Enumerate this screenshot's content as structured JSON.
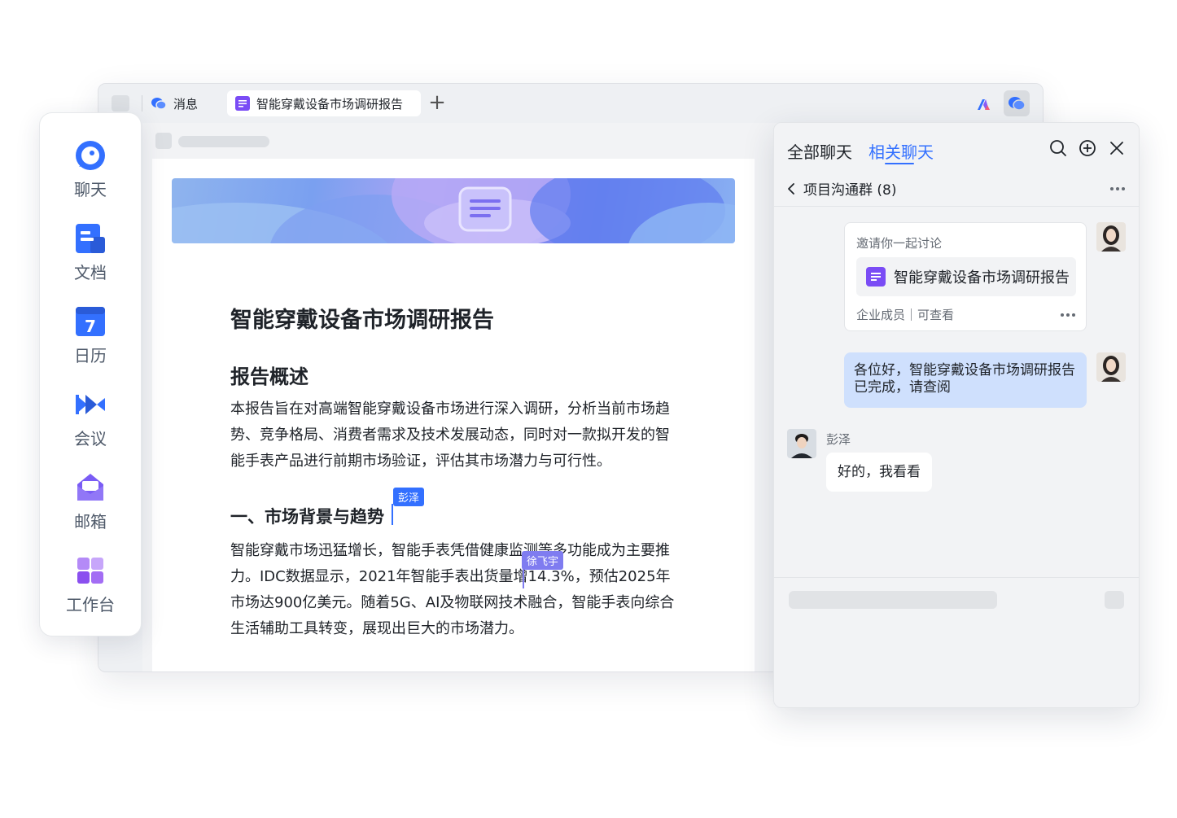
{
  "tabs": {
    "messages_label": "消息",
    "doc_label": "智能穿戴设备市场调研报告",
    "new_tab": "+"
  },
  "dock": {
    "items": [
      {
        "label": "聊天",
        "icon": "chat-bubble-icon"
      },
      {
        "label": "文档",
        "icon": "document-icon"
      },
      {
        "label": "日历",
        "icon": "calendar-icon"
      },
      {
        "label": "会议",
        "icon": "video-camera-icon"
      },
      {
        "label": "邮箱",
        "icon": "mail-icon"
      },
      {
        "label": "工作台",
        "icon": "workspace-icon"
      }
    ],
    "calendar_day": "7"
  },
  "document": {
    "title": "智能穿戴设备市场调研报告",
    "section1_heading": "报告概述",
    "section1_text": "本报告旨在对高端智能穿戴设备市场进行深入调研，分析当前市场趋势、竞争格局、消费者需求及技术发展动态，同时对一款拟开发的智能手表产品进行前期市场验证，评估其市场潜力与可行性。",
    "section2_heading": "一、市场背景与趋势",
    "section2_text": "智能穿戴市场迅猛增长，智能手表凭借健康监测等多功能成为主要推力。IDC数据显示，2021年智能手表出货量增14.3%，预估2025年市场达900亿美元。随着5G、AI及物联网技术融合，智能手表向综合生活辅助工具转变，展现出巨大的市场潜力。",
    "collaborators": [
      {
        "name": "彭泽",
        "color": "#3370ff"
      },
      {
        "name": "徐飞宇",
        "color": "#7f7cf0"
      }
    ]
  },
  "chat": {
    "tab_all": "全部聊天",
    "tab_related": "相关聊天",
    "group_name": "项目沟通群 (8)",
    "card": {
      "invite_text": "邀请你一起讨论",
      "doc_name": "智能穿戴设备市场调研报告",
      "permission": "企业成员｜可查看"
    },
    "my_message": "各位好，智能穿戴设备市场调研报告已完成，请查阅",
    "peer_name": "彭泽",
    "peer_message": "好的，我看看"
  },
  "colors": {
    "accent": "#3370ff",
    "doc_icon": "#7a4cf5",
    "my_bubble": "#cfe0fd"
  }
}
